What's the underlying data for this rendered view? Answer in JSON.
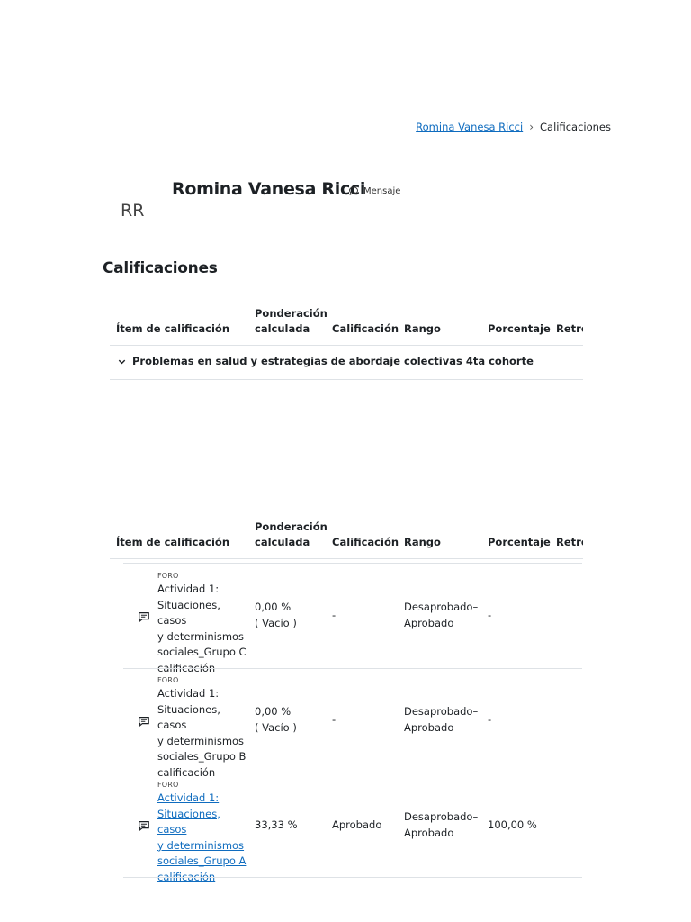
{
  "breadcrumb": {
    "user": "Romina Vanesa Ricci",
    "current": "Calificaciones"
  },
  "profile": {
    "initials": "RR",
    "name": "Romina Vanesa Ricci",
    "message_label": "Mensaje"
  },
  "section_title": "Calificaciones",
  "table": {
    "headers": {
      "item": "Ítem de calificación",
      "weight_line1": "Ponderación",
      "weight_line2": "calculada",
      "grade": "Calificación",
      "range": "Rango",
      "percentage": "Porcentaje",
      "feedback": "Retro"
    },
    "category": "Problemas en salud y estrategias de abordaje colectivas 4ta cohorte",
    "rows": [
      {
        "type": "FORO",
        "name_lines": [
          "Actividad 1:",
          "Situaciones, casos",
          "y determinismos",
          "sociales_Grupo C",
          "calificación"
        ],
        "weight_line1": "0,00 %",
        "weight_line2": "( Vacío )",
        "grade": "-",
        "range_line1": "Desaprobado–",
        "range_line2": "Aprobado",
        "percentage": "-"
      },
      {
        "type": "FORO",
        "name_lines": [
          "Actividad 1:",
          "Situaciones, casos",
          "y determinismos",
          "sociales_Grupo B",
          "calificación"
        ],
        "weight_line1": "0,00 %",
        "weight_line2": "( Vacío )",
        "grade": "-",
        "range_line1": "Desaprobado–",
        "range_line2": "Aprobado",
        "percentage": "-"
      },
      {
        "type": "FORO",
        "name_lines": [
          "Actividad 1:",
          "Situaciones, casos",
          "y determinismos",
          "sociales_Grupo A",
          "calificación"
        ],
        "weight_line1": "33,33 %",
        "grade": "Aprobado",
        "range_line1": "Desaprobado–",
        "range_line2": "Aprobado",
        "percentage": "100,00 %"
      }
    ]
  }
}
